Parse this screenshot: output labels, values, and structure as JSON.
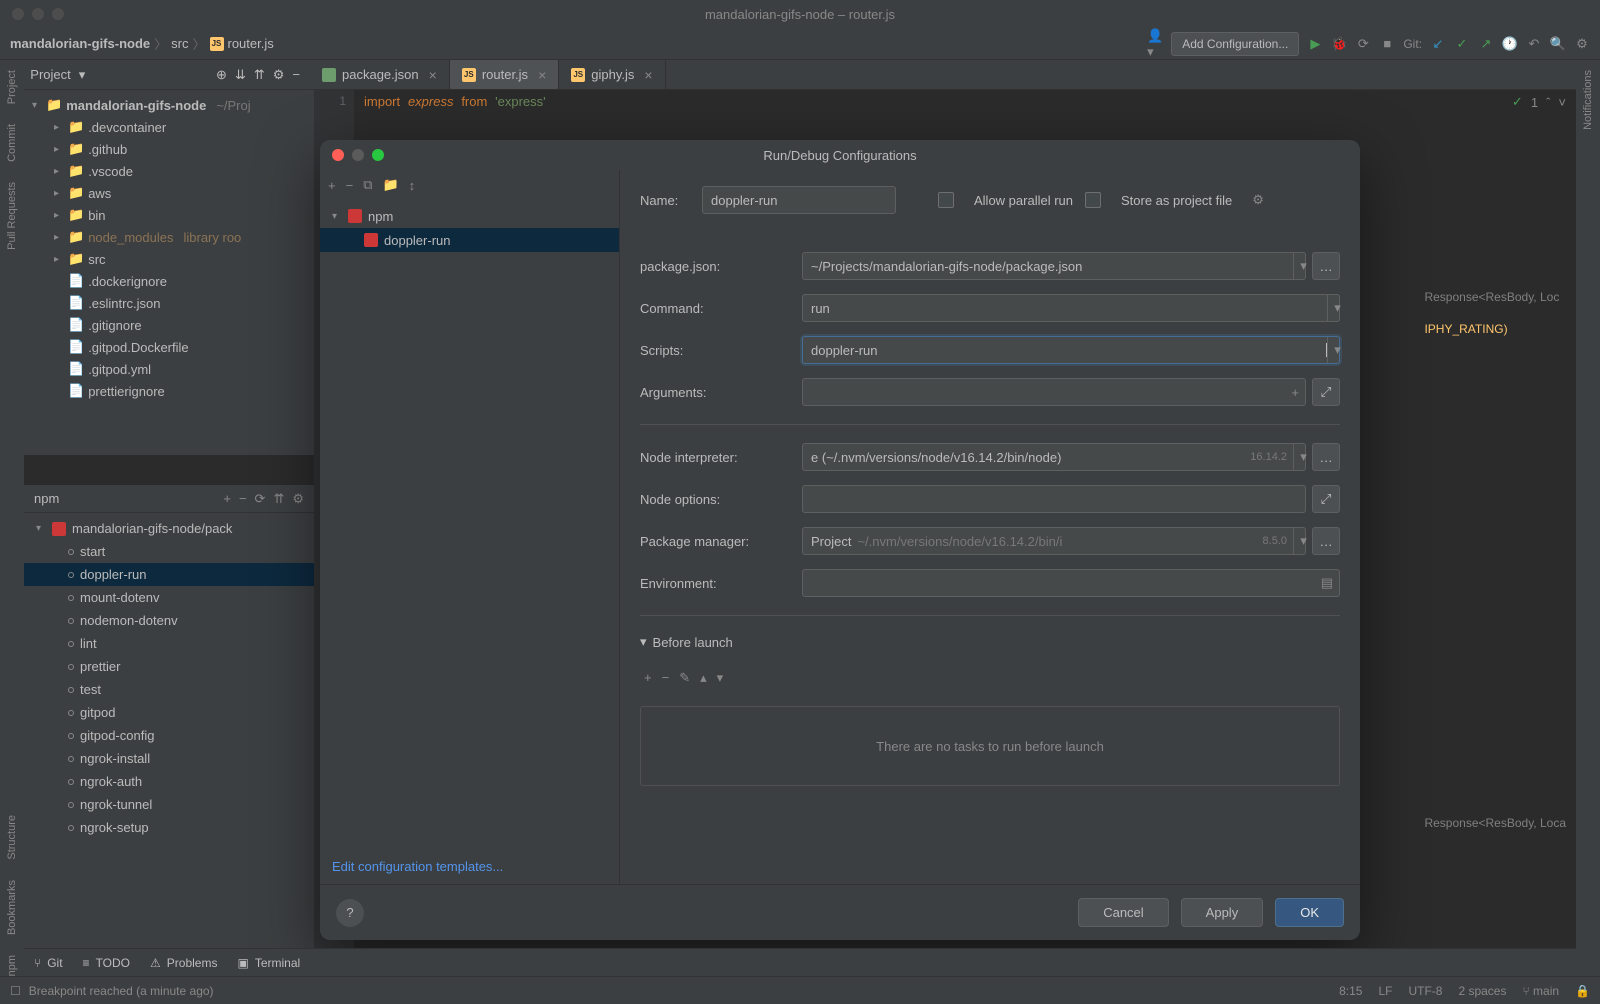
{
  "titlebar": {
    "title": "mandalorian-gifs-node – router.js"
  },
  "breadcrumb": {
    "root": "mandalorian-gifs-node",
    "folder": "src",
    "file": "router.js"
  },
  "toolbar": {
    "add_config": "Add Configuration...",
    "git_label": "Git:"
  },
  "tabs": [
    {
      "name": "package.json",
      "active": false
    },
    {
      "name": "router.js",
      "active": true
    },
    {
      "name": "giphy.js",
      "active": false
    }
  ],
  "project_header": {
    "label": "Project"
  },
  "left_strip": [
    "Project",
    "Commit",
    "Pull Requests",
    "Structure",
    "Bookmarks",
    "npm"
  ],
  "right_strip": [
    "Notifications"
  ],
  "tree": {
    "root": "mandalorian-gifs-node",
    "root_path": "~/Proj",
    "items": [
      {
        "name": ".devcontainer",
        "type": "folder"
      },
      {
        "name": ".github",
        "type": "folder"
      },
      {
        "name": ".vscode",
        "type": "folder"
      },
      {
        "name": "aws",
        "type": "folder"
      },
      {
        "name": "bin",
        "type": "folder"
      },
      {
        "name": "node_modules",
        "type": "folder",
        "suffix": "library roo"
      },
      {
        "name": "src",
        "type": "folder"
      },
      {
        "name": ".dockerignore",
        "type": "file"
      },
      {
        "name": ".eslintrc.json",
        "type": "file"
      },
      {
        "name": ".gitignore",
        "type": "file"
      },
      {
        "name": ".gitpod.Dockerfile",
        "type": "file"
      },
      {
        "name": ".gitpod.yml",
        "type": "file"
      },
      {
        "name": "prettierignore",
        "type": "file"
      }
    ]
  },
  "npm_panel": {
    "title": "npm",
    "root": "mandalorian-gifs-node/pack",
    "scripts": [
      "start",
      "doppler-run",
      "mount-dotenv",
      "nodemon-dotenv",
      "lint",
      "prettier",
      "test",
      "gitpod",
      "gitpod-config",
      "ngrok-install",
      "ngrok-auth",
      "ngrok-tunnel",
      "ngrok-setup"
    ],
    "selected": "doppler-run"
  },
  "editor": {
    "line_no": "1",
    "code": {
      "import": "import",
      "express": "express",
      "from": "from",
      "module": "'express'"
    },
    "errors": "1",
    "hints": [
      "Response<ResBody, Loc",
      "IPHY_RATING)",
      "Response<ResBody, Loca"
    ]
  },
  "dialog": {
    "title": "Run/Debug Configurations",
    "tree": {
      "npm": "npm",
      "doppler_run": "doppler-run"
    },
    "edit_templates": "Edit configuration templates...",
    "name_label": "Name:",
    "name_value": "doppler-run",
    "allow_parallel": "Allow parallel run",
    "store_project": "Store as project file",
    "package_json_label": "package.json:",
    "package_json_value": "~/Projects/mandalorian-gifs-node/package.json",
    "command_label": "Command:",
    "command_value": "run",
    "scripts_label": "Scripts:",
    "scripts_value": "doppler-run",
    "arguments_label": "Arguments:",
    "arguments_value": "",
    "node_interpreter_label": "Node interpreter:",
    "node_interpreter_value": "e (~/.nvm/versions/node/v16.14.2/bin/node)",
    "node_version": "16.14.2",
    "node_options_label": "Node options:",
    "node_options_value": "",
    "package_manager_label": "Package manager:",
    "package_manager_prefix": "Project",
    "package_manager_value": "~/.nvm/versions/node/v16.14.2/bin/i",
    "package_manager_version": "8.5.0",
    "environment_label": "Environment:",
    "environment_value": "",
    "before_launch": "Before launch",
    "tasks_empty": "There are no tasks to run before launch",
    "cancel": "Cancel",
    "apply": "Apply",
    "ok": "OK"
  },
  "bottom_bar": {
    "git": "Git",
    "todo": "TODO",
    "problems": "Problems",
    "terminal": "Terminal"
  },
  "status": {
    "message": "Breakpoint reached (a minute ago)",
    "position": "8:15",
    "line_ending": "LF",
    "encoding": "UTF-8",
    "indent": "2 spaces",
    "branch": "main"
  }
}
